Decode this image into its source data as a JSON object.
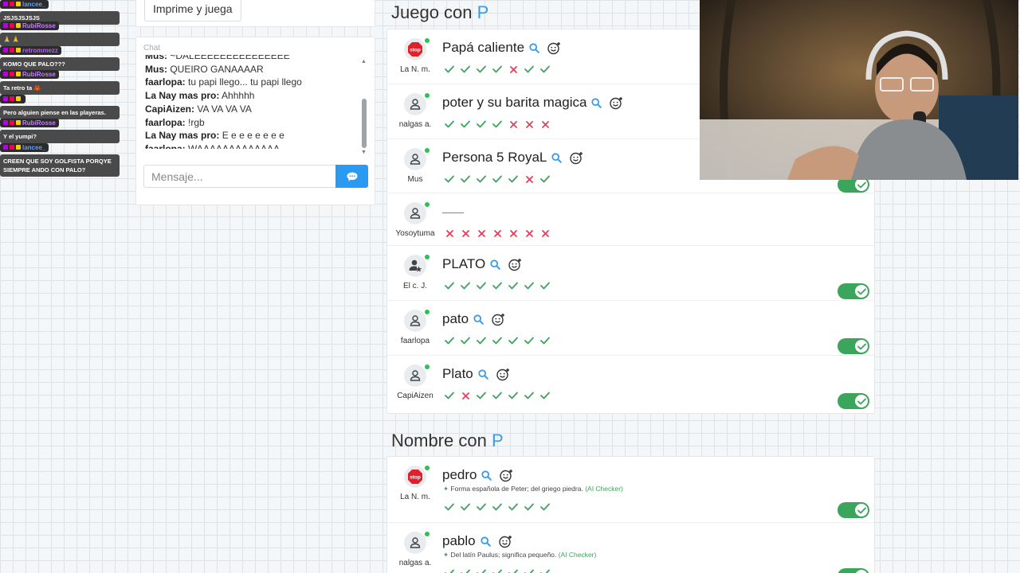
{
  "overlay_chat": [
    {
      "name": "lancee_",
      "name_color": "#5aa0ff",
      "text": "JSJSJSJSJS"
    },
    {
      "name": "RubiRosse",
      "name_color": "#c77dff",
      "text": "🙏 🙏"
    },
    {
      "name": "retrommezz",
      "name_color": "#b45cff",
      "text": "KOMO QUE PALO???"
    },
    {
      "name": "RubiRosse",
      "name_color": "#c77dff",
      "text": "Ta retro ta 🦀"
    },
    {
      "name": "",
      "name_color": "#c77dff",
      "text": "Pero alguien piense en las playeras."
    },
    {
      "name": "RubiRosse",
      "name_color": "#c77dff",
      "text": "Y el yumpi?"
    },
    {
      "name": "lancee_",
      "name_color": "#5aa0ff",
      "text": "CREEN QUE SOY GOLFISTA PORQYE SIEMPRE ANDO CON PALO?"
    }
  ],
  "print_button": "Imprime y juega",
  "chat": {
    "title": "Chat",
    "messages": [
      {
        "user": "Mus:",
        "text": "~DALEEEEEEEEEEEEEEE"
      },
      {
        "user": "Mus:",
        "text": "QUEIRO GANAAAAR"
      },
      {
        "user": "faarlopa:",
        "text": "tu papi llego... tu papi llego"
      },
      {
        "user": "La Nay mas pro:",
        "text": "Ahhhhh"
      },
      {
        "user": "CapiAizen:",
        "text": "VA VA VA VA"
      },
      {
        "user": "faarlopa:",
        "text": "!rgb"
      },
      {
        "user": "La Nay mas pro:",
        "text": "E e e e e e e e"
      },
      {
        "user": "faarlopa:",
        "text": "WAAAAAAAAAAAAA"
      }
    ],
    "input_placeholder": "Mensaje..."
  },
  "section_juego": {
    "prefix": "Juego con",
    "letter": "P",
    "rows": [
      {
        "player": "La N. m.",
        "avatar": "stop",
        "word": "Papá caliente",
        "marks": [
          "ok",
          "ok",
          "ok",
          "ok",
          "x",
          "ok",
          "ok"
        ],
        "toggle": false
      },
      {
        "player": "nalgas a.",
        "avatar": "user",
        "word": "poter y su barita magica",
        "marks": [
          "ok",
          "ok",
          "ok",
          "ok",
          "x",
          "x",
          "x"
        ],
        "toggle": false
      },
      {
        "player": "Mus",
        "avatar": "user",
        "word": "Persona 5 RoyaL",
        "marks": [
          "ok",
          "ok",
          "ok",
          "ok",
          "ok",
          "x",
          "ok"
        ],
        "toggle": true
      },
      {
        "player": "Yosoytuma",
        "avatar": "user",
        "word": "",
        "marks": [
          "x",
          "x",
          "x",
          "x",
          "x",
          "x",
          "x"
        ],
        "toggle": false
      },
      {
        "player": "El c. J.",
        "avatar": "star",
        "word": "PLATO",
        "marks": [
          "ok",
          "ok",
          "ok",
          "ok",
          "ok",
          "ok",
          "ok"
        ],
        "toggle": true
      },
      {
        "player": "faarlopa",
        "avatar": "user",
        "word": "pato",
        "marks": [
          "ok",
          "ok",
          "ok",
          "ok",
          "ok",
          "ok",
          "ok"
        ],
        "toggle": true
      },
      {
        "player": "CapiAizen",
        "avatar": "user",
        "word": "Plato",
        "marks": [
          "ok",
          "x",
          "ok",
          "ok",
          "ok",
          "ok",
          "ok"
        ],
        "toggle": true
      }
    ]
  },
  "section_nombre": {
    "prefix": "Nombre con",
    "letter": "P",
    "rows": [
      {
        "player": "La N. m.",
        "avatar": "stop",
        "word": "pedro",
        "hint": "Forma española de Peter; del griego piedra.",
        "hint_source": "(AI Checker)",
        "marks": [
          "ok",
          "ok",
          "ok",
          "ok",
          "ok",
          "ok",
          "ok"
        ],
        "toggle": true
      },
      {
        "player": "nalgas a.",
        "avatar": "user",
        "word": "pablo",
        "hint": "Del latín Paulus; significa pequeño.",
        "hint_source": "(AI Checker)",
        "marks": [
          "ok",
          "ok",
          "ok",
          "ok",
          "ok",
          "ok",
          "ok"
        ],
        "toggle": true
      }
    ]
  },
  "icons": {
    "search": "search-icon",
    "smile": "smile-plus-icon",
    "send": "chat-bubble-icon",
    "check": "check-icon",
    "cross": "cross-icon"
  },
  "colors": {
    "accent": "#2b9af3",
    "ok": "#3ba55c",
    "bad": "#e0435c",
    "toggle_on": "#3ba55c",
    "letter": "#3a9be8"
  }
}
